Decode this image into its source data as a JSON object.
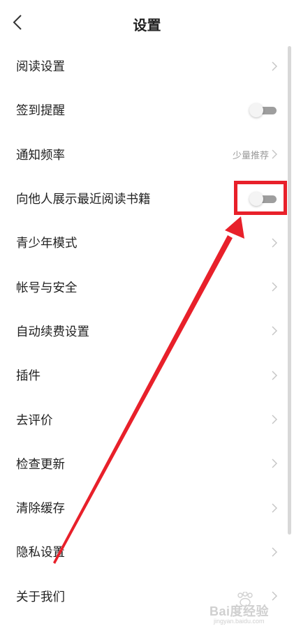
{
  "header": {
    "title": "设置",
    "back_icon": "chevron-left-icon"
  },
  "settings": [
    {
      "label": "阅读设置",
      "control": "chevron"
    },
    {
      "label": "签到提醒",
      "control": "toggle",
      "on": false
    },
    {
      "label": "通知频率",
      "control": "chevron",
      "value": "少量推荐"
    },
    {
      "label": "向他人展示最近阅读书籍",
      "control": "toggle",
      "on": false
    },
    {
      "label": "青少年模式",
      "control": "chevron"
    },
    {
      "label": "帐号与安全",
      "control": "chevron"
    },
    {
      "label": "自动续费设置",
      "control": "chevron"
    },
    {
      "label": "插件",
      "control": "chevron"
    },
    {
      "label": "去评价",
      "control": "chevron"
    },
    {
      "label": "检查更新",
      "control": "chevron"
    },
    {
      "label": "清除缓存",
      "control": "chevron"
    },
    {
      "label": "隐私设置",
      "control": "chevron"
    },
    {
      "label": "关于我们",
      "control": "chevron"
    }
  ],
  "watermark": {
    "text": "Bai度经验",
    "sub": "jingyan.baidu.com"
  },
  "colors": {
    "annotation": "#e8202a",
    "toggle_off": "#9e9e9e",
    "chevron": "#c4c4c4"
  }
}
